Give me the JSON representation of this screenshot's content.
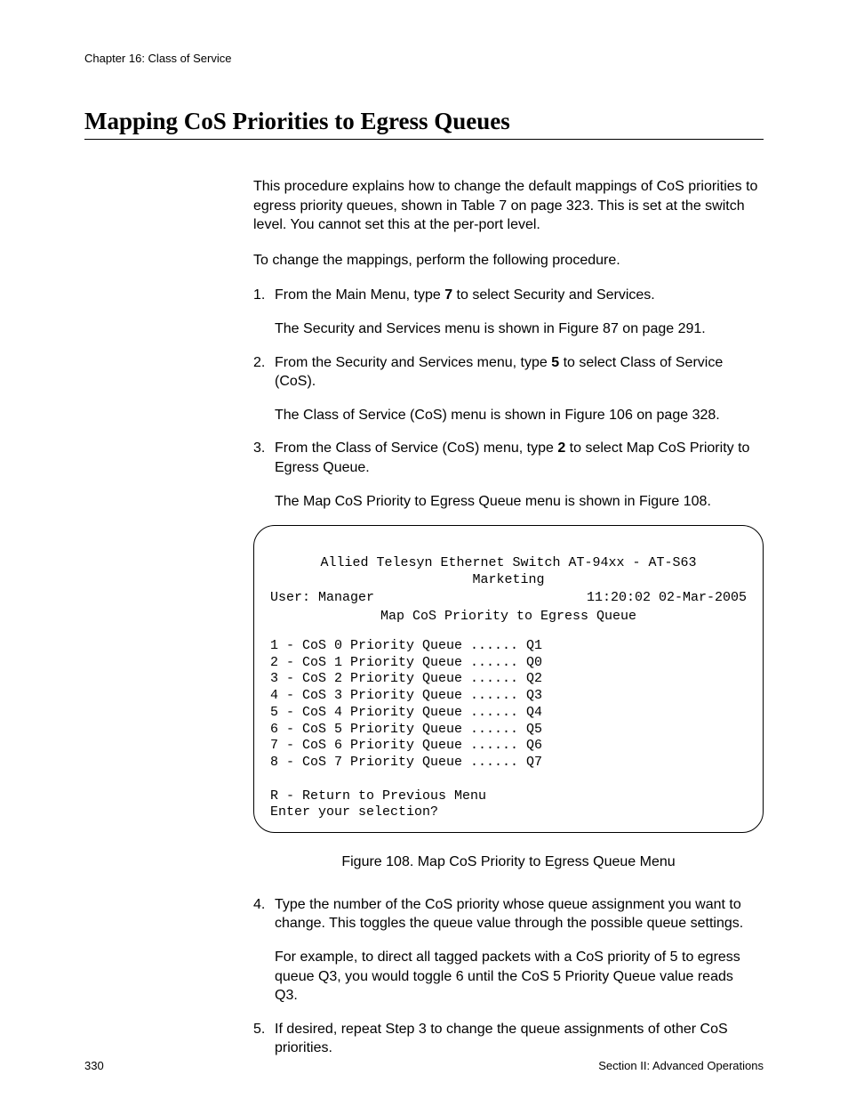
{
  "header": {
    "chapter": "Chapter 16: Class of Service"
  },
  "title": "Mapping CoS Priorities to Egress Queues",
  "intro1": "This procedure explains how to change the default mappings of CoS priorities to egress priority queues, shown in Table 7 on page 323. This is set at the switch level. You cannot set this at the per-port level.",
  "intro2": "To change the mappings, perform the following procedure.",
  "steps": {
    "s1": {
      "num": "1.",
      "text_a": "From the Main Menu, type ",
      "bold": "7",
      "text_b": " to select Security and Services.",
      "after": "The Security and Services menu is shown in Figure 87 on page 291."
    },
    "s2": {
      "num": "2.",
      "text_a": "From the Security and Services menu, type ",
      "bold": "5",
      "text_b": " to select Class of Service (CoS).",
      "after": "The Class of Service (CoS) menu is shown in Figure 106 on page 328."
    },
    "s3": {
      "num": "3.",
      "text_a": "From the Class of Service (CoS) menu, type ",
      "bold": "2",
      "text_b": " to select Map CoS Priority to Egress Queue.",
      "after": "The Map CoS Priority to Egress Queue menu is shown in Figure 108."
    },
    "s4": {
      "num": "4.",
      "text": "Type the number of the CoS priority whose queue assignment you want to change. This toggles the queue value through the possible queue settings.",
      "after": "For example, to direct all tagged packets with a CoS priority of 5 to egress queue Q3, you would toggle 6 until the CoS 5 Priority Queue value reads Q3."
    },
    "s5": {
      "num": "5.",
      "text": "If desired, repeat Step 3 to change the queue assignments of other CoS priorities."
    }
  },
  "terminal": {
    "line1": "Allied Telesyn Ethernet Switch AT-94xx - AT-S63",
    "line2": "Marketing",
    "user": "User: Manager",
    "timestamp": "11:20:02 02-Mar-2005",
    "menu_title": "Map CoS Priority to Egress Queue",
    "items": [
      "1 - CoS 0 Priority Queue ...... Q1",
      "2 - CoS 1 Priority Queue ...... Q0",
      "3 - CoS 2 Priority Queue ...... Q2",
      "4 - CoS 3 Priority Queue ...... Q3",
      "5 - CoS 4 Priority Queue ...... Q4",
      "6 - CoS 5 Priority Queue ...... Q5",
      "7 - CoS 6 Priority Queue ...... Q6",
      "8 - CoS 7 Priority Queue ...... Q7"
    ],
    "return": "R - Return to Previous Menu",
    "prompt": "Enter your selection?"
  },
  "figure_caption": "Figure 108. Map CoS Priority to Egress Queue Menu",
  "footer": {
    "page": "330",
    "section": "Section II: Advanced Operations"
  }
}
